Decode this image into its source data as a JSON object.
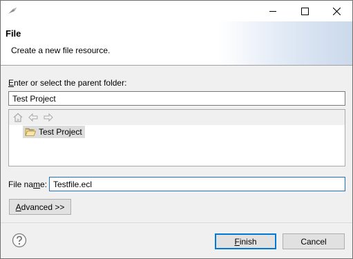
{
  "banner": {
    "title": "File",
    "description": "Create a new file resource."
  },
  "parent_folder": {
    "label": "Enter or select the parent folder:",
    "value": "Test Project"
  },
  "tree": {
    "items": [
      {
        "label": "Test Project",
        "icon": "open-folder-icon",
        "selected": true
      }
    ],
    "toolbar_icons": [
      "home-icon",
      "back-arrow-icon",
      "forward-arrow-icon"
    ]
  },
  "file_name": {
    "label": "File name:",
    "value": "Testfile.ecl"
  },
  "buttons": {
    "advanced": "Advanced >>",
    "finish": "Finish",
    "cancel": "Cancel"
  },
  "colors": {
    "focus_border": "#1e6fc8",
    "default_button_border": "#0078d7",
    "selection": "#dcdcdc"
  }
}
